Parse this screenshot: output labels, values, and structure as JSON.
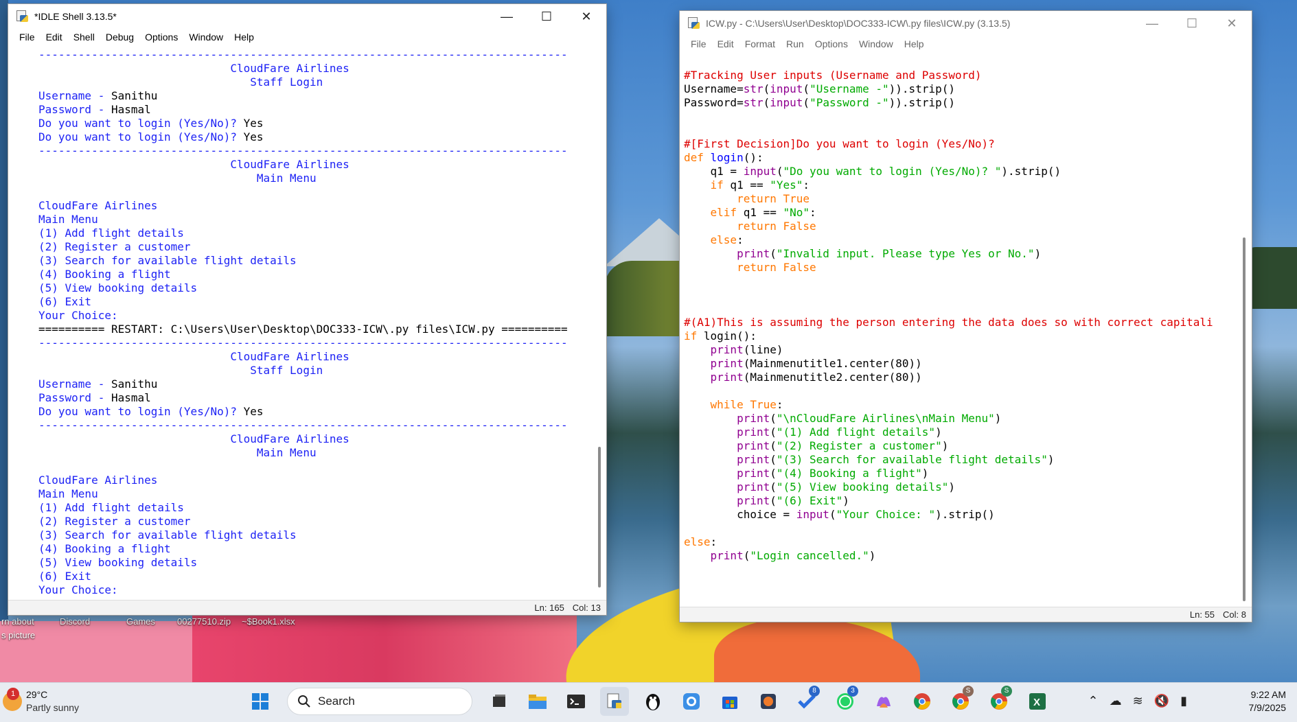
{
  "desktop": {
    "labels": [
      "rn about",
      "s picture",
      "Discord",
      "Games",
      "00277510.zip",
      "~$Book1.xlsx"
    ]
  },
  "shell_window": {
    "title": "*IDLE Shell 3.13.5*",
    "menu": [
      "File",
      "Edit",
      "Shell",
      "Debug",
      "Options",
      "Window",
      "Help"
    ],
    "status_ln": "Ln: 165",
    "status_col": "Col: 13",
    "lines": [
      {
        "t": "--------------------------------------------------------------------------------",
        "c": "blue"
      },
      {
        "t": "                             CloudFare Airlines",
        "c": "blue"
      },
      {
        "t": "                                Staff Login",
        "c": "blue"
      },
      {
        "t": "Username - ",
        "c": "blue",
        "u": "Sanithu"
      },
      {
        "t": "Password - ",
        "c": "blue",
        "u": "Hasmal"
      },
      {
        "t": "Do you want to login (Yes/No)? ",
        "c": "blue",
        "u": "Yes"
      },
      {
        "t": "Do you want to login (Yes/No)? ",
        "c": "blue",
        "u": "Yes"
      },
      {
        "t": "--------------------------------------------------------------------------------",
        "c": "blue"
      },
      {
        "t": "                             CloudFare Airlines",
        "c": "blue"
      },
      {
        "t": "                                 Main Menu",
        "c": "blue"
      },
      {
        "t": "",
        "c": "blue"
      },
      {
        "t": "CloudFare Airlines",
        "c": "blue"
      },
      {
        "t": "Main Menu",
        "c": "blue"
      },
      {
        "t": "(1) Add flight details",
        "c": "blue"
      },
      {
        "t": "(2) Register a customer",
        "c": "blue"
      },
      {
        "t": "(3) Search for available flight details",
        "c": "blue"
      },
      {
        "t": "(4) Booking a flight",
        "c": "blue"
      },
      {
        "t": "(5) View booking details",
        "c": "blue"
      },
      {
        "t": "(6) Exit",
        "c": "blue"
      },
      {
        "t": "Your Choice:",
        "c": "blue"
      },
      {
        "t": "========== RESTART: C:\\Users\\User\\Desktop\\DOC333-ICW\\.py files\\ICW.py ==========",
        "c": "black"
      },
      {
        "t": "--------------------------------------------------------------------------------",
        "c": "blue"
      },
      {
        "t": "                             CloudFare Airlines",
        "c": "blue"
      },
      {
        "t": "                                Staff Login",
        "c": "blue"
      },
      {
        "t": "Username - ",
        "c": "blue",
        "u": "Sanithu"
      },
      {
        "t": "Password - ",
        "c": "blue",
        "u": "Hasmal"
      },
      {
        "t": "Do you want to login (Yes/No)? ",
        "c": "blue",
        "u": "Yes"
      },
      {
        "t": "--------------------------------------------------------------------------------",
        "c": "blue"
      },
      {
        "t": "                             CloudFare Airlines",
        "c": "blue"
      },
      {
        "t": "                                 Main Menu",
        "c": "blue"
      },
      {
        "t": "",
        "c": "blue"
      },
      {
        "t": "CloudFare Airlines",
        "c": "blue"
      },
      {
        "t": "Main Menu",
        "c": "blue"
      },
      {
        "t": "(1) Add flight details",
        "c": "blue"
      },
      {
        "t": "(2) Register a customer",
        "c": "blue"
      },
      {
        "t": "(3) Search for available flight details",
        "c": "blue"
      },
      {
        "t": "(4) Booking a flight",
        "c": "blue"
      },
      {
        "t": "(5) View booking details",
        "c": "blue"
      },
      {
        "t": "(6) Exit",
        "c": "blue"
      },
      {
        "t": "Your Choice:",
        "c": "blue"
      }
    ]
  },
  "editor_window": {
    "title": "ICW.py - C:\\Users\\User\\Desktop\\DOC333-ICW\\.py files\\ICW.py (3.13.5)",
    "menu": [
      "File",
      "Edit",
      "Format",
      "Run",
      "Options",
      "Window",
      "Help"
    ],
    "status_ln": "Ln: 55",
    "status_col": "Col: 8",
    "lines": [
      [],
      [
        {
          "t": "#Tracking User inputs (Username and Password)",
          "c": "cm"
        }
      ],
      [
        {
          "t": "Username=",
          "c": "black"
        },
        {
          "t": "str",
          "c": "bi"
        },
        {
          "t": "(",
          "c": "black"
        },
        {
          "t": "input",
          "c": "bi"
        },
        {
          "t": "(",
          "c": "black"
        },
        {
          "t": "\"Username -\"",
          "c": "str"
        },
        {
          "t": ")).strip()",
          "c": "black"
        }
      ],
      [
        {
          "t": "Password=",
          "c": "black"
        },
        {
          "t": "str",
          "c": "bi"
        },
        {
          "t": "(",
          "c": "black"
        },
        {
          "t": "input",
          "c": "bi"
        },
        {
          "t": "(",
          "c": "black"
        },
        {
          "t": "\"Password -\"",
          "c": "str"
        },
        {
          "t": ")).strip()",
          "c": "black"
        }
      ],
      [],
      [],
      [
        {
          "t": "#[First Decision]Do you want to login (Yes/No)?",
          "c": "cm"
        }
      ],
      [
        {
          "t": "def ",
          "c": "kw"
        },
        {
          "t": "login",
          "c": "fn"
        },
        {
          "t": "():",
          "c": "black"
        }
      ],
      [
        {
          "t": "    q1 = ",
          "c": "black"
        },
        {
          "t": "input",
          "c": "bi"
        },
        {
          "t": "(",
          "c": "black"
        },
        {
          "t": "\"Do you want to login (Yes/No)? \"",
          "c": "str"
        },
        {
          "t": ").strip()",
          "c": "black"
        }
      ],
      [
        {
          "t": "    ",
          "c": "black"
        },
        {
          "t": "if",
          "c": "kw"
        },
        {
          "t": " q1 == ",
          "c": "black"
        },
        {
          "t": "\"Yes\"",
          "c": "str"
        },
        {
          "t": ":",
          "c": "black"
        }
      ],
      [
        {
          "t": "        ",
          "c": "black"
        },
        {
          "t": "return True",
          "c": "kw"
        }
      ],
      [
        {
          "t": "    ",
          "c": "black"
        },
        {
          "t": "elif",
          "c": "kw"
        },
        {
          "t": " q1 == ",
          "c": "black"
        },
        {
          "t": "\"No\"",
          "c": "str"
        },
        {
          "t": ":",
          "c": "black"
        }
      ],
      [
        {
          "t": "        ",
          "c": "black"
        },
        {
          "t": "return False",
          "c": "kw"
        }
      ],
      [
        {
          "t": "    ",
          "c": "black"
        },
        {
          "t": "else",
          "c": "kw"
        },
        {
          "t": ":",
          "c": "black"
        }
      ],
      [
        {
          "t": "        ",
          "c": "black"
        },
        {
          "t": "print",
          "c": "bi"
        },
        {
          "t": "(",
          "c": "black"
        },
        {
          "t": "\"Invalid input. Please type Yes or No.\"",
          "c": "str"
        },
        {
          "t": ")",
          "c": "black"
        }
      ],
      [
        {
          "t": "        ",
          "c": "black"
        },
        {
          "t": "return False",
          "c": "kw"
        }
      ],
      [],
      [],
      [],
      [
        {
          "t": "#(A1)This is assuming the person entering the data does so with correct capitali",
          "c": "cm"
        }
      ],
      [
        {
          "t": "if",
          "c": "kw"
        },
        {
          "t": " login():",
          "c": "black"
        }
      ],
      [
        {
          "t": "    ",
          "c": "black"
        },
        {
          "t": "print",
          "c": "bi"
        },
        {
          "t": "(line)",
          "c": "black"
        }
      ],
      [
        {
          "t": "    ",
          "c": "black"
        },
        {
          "t": "print",
          "c": "bi"
        },
        {
          "t": "(Mainmenutitle1.center(80))",
          "c": "black"
        }
      ],
      [
        {
          "t": "    ",
          "c": "black"
        },
        {
          "t": "print",
          "c": "bi"
        },
        {
          "t": "(Mainmenutitle2.center(80))",
          "c": "black"
        }
      ],
      [],
      [
        {
          "t": "    ",
          "c": "black"
        },
        {
          "t": "while True",
          "c": "kw"
        },
        {
          "t": ":",
          "c": "black"
        }
      ],
      [
        {
          "t": "        ",
          "c": "black"
        },
        {
          "t": "print",
          "c": "bi"
        },
        {
          "t": "(",
          "c": "black"
        },
        {
          "t": "\"\\nCloudFare Airlines\\nMain Menu\"",
          "c": "str"
        },
        {
          "t": ")",
          "c": "black"
        }
      ],
      [
        {
          "t": "        ",
          "c": "black"
        },
        {
          "t": "print",
          "c": "bi"
        },
        {
          "t": "(",
          "c": "black"
        },
        {
          "t": "\"(1) Add flight details\"",
          "c": "str"
        },
        {
          "t": ")",
          "c": "black"
        }
      ],
      [
        {
          "t": "        ",
          "c": "black"
        },
        {
          "t": "print",
          "c": "bi"
        },
        {
          "t": "(",
          "c": "black"
        },
        {
          "t": "\"(2) Register a customer\"",
          "c": "str"
        },
        {
          "t": ")",
          "c": "black"
        }
      ],
      [
        {
          "t": "        ",
          "c": "black"
        },
        {
          "t": "print",
          "c": "bi"
        },
        {
          "t": "(",
          "c": "black"
        },
        {
          "t": "\"(3) Search for available flight details\"",
          "c": "str"
        },
        {
          "t": ")",
          "c": "black"
        }
      ],
      [
        {
          "t": "        ",
          "c": "black"
        },
        {
          "t": "print",
          "c": "bi"
        },
        {
          "t": "(",
          "c": "black"
        },
        {
          "t": "\"(4) Booking a flight\"",
          "c": "str"
        },
        {
          "t": ")",
          "c": "black"
        }
      ],
      [
        {
          "t": "        ",
          "c": "black"
        },
        {
          "t": "print",
          "c": "bi"
        },
        {
          "t": "(",
          "c": "black"
        },
        {
          "t": "\"(5) View booking details\"",
          "c": "str"
        },
        {
          "t": ")",
          "c": "black"
        }
      ],
      [
        {
          "t": "        ",
          "c": "black"
        },
        {
          "t": "print",
          "c": "bi"
        },
        {
          "t": "(",
          "c": "black"
        },
        {
          "t": "\"(6) Exit\"",
          "c": "str"
        },
        {
          "t": ")",
          "c": "black"
        }
      ],
      [
        {
          "t": "        choice = ",
          "c": "black"
        },
        {
          "t": "input",
          "c": "bi"
        },
        {
          "t": "(",
          "c": "black"
        },
        {
          "t": "\"Your Choice: \"",
          "c": "str"
        },
        {
          "t": ").strip()",
          "c": "black"
        }
      ],
      [],
      [
        {
          "t": "else",
          "c": "kw"
        },
        {
          "t": ":",
          "c": "black"
        }
      ],
      [
        {
          "t": "    ",
          "c": "black"
        },
        {
          "t": "print",
          "c": "bi"
        },
        {
          "t": "(",
          "c": "black"
        },
        {
          "t": "\"Login cancelled.\"",
          "c": "str"
        },
        {
          "t": ")",
          "c": "black"
        }
      ]
    ]
  },
  "taskbar": {
    "weather_temp": "29°C",
    "weather_desc": "Partly sunny",
    "weather_badge": "1",
    "search_label": "Search",
    "badge_todo": "8",
    "badge_whatsapp": "3",
    "badge_chrome_s1": "S",
    "badge_chrome_s2": "S",
    "time": "9:22 AM",
    "date": "7/9/2025",
    "apps": [
      "start-icon",
      "search-icon",
      "task-view-icon",
      "file-explorer-icon",
      "terminal-icon",
      "idle-python-icon",
      "penguin-app-icon",
      "app-blue-icon",
      "microsoft-store-icon",
      "media-app-icon",
      "todo-icon",
      "whatsapp-icon",
      "copilot-icon",
      "chrome-icon",
      "chrome-profile-s1-icon",
      "chrome-profile-s2-icon",
      "excel-icon"
    ]
  }
}
